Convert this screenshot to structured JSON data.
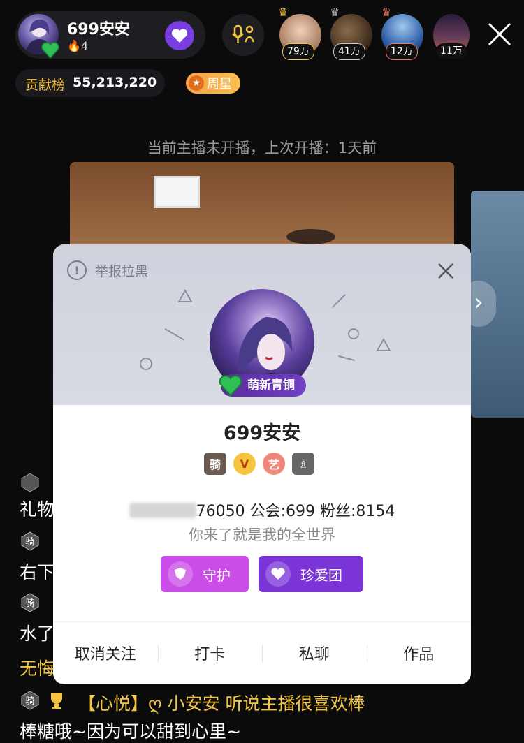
{
  "host": {
    "name": "699安安",
    "fans": "4"
  },
  "viewers": [
    {
      "count": "79万",
      "color": "#f2c84b"
    },
    {
      "count": "41万",
      "color": "#c9c9c9"
    },
    {
      "count": "12万",
      "color": "#e8775d"
    },
    {
      "count": "11万",
      "color": "#222222"
    }
  ],
  "contribution": {
    "label": "贡献榜",
    "value": "55,213,220"
  },
  "week_star": {
    "label": "周星"
  },
  "status": {
    "offline_text": "当前主播未开播，上次开播：1天前"
  },
  "chat": {
    "lines": [
      {
        "text": "礼物"
      },
      {
        "text": "右下"
      },
      {
        "text": "水了"
      },
      {
        "text": "无悔"
      },
      {
        "text": "【心悦】ღ 小安安  听说主播很喜欢棒"
      },
      {
        "text": "棒糖哦~因为可以甜到心里~"
      }
    ],
    "badge_label": "骑"
  },
  "profile": {
    "report_label": "举报拉黑",
    "level_label": "萌新青铜",
    "name": "699安安",
    "badges": {
      "ride": "骑",
      "vip": "V",
      "art": "艺"
    },
    "id_suffix": "76050",
    "guild": "公会:699",
    "fans": "粉丝:8154",
    "bio": "你来了就是我的全世界",
    "guard_label": "守护",
    "club_label": "珍爱团",
    "actions": [
      "取消关注",
      "打卡",
      "私聊",
      "作品"
    ]
  },
  "colors": {
    "accent_purple": "#7b35d6",
    "guard_pink": "#c94de6",
    "gold": "#f4c542"
  },
  "icons": [
    "heart-badge-icon",
    "microphone-icon",
    "close-icon",
    "info-icon",
    "chevron-right-icon",
    "crown-icon"
  ]
}
